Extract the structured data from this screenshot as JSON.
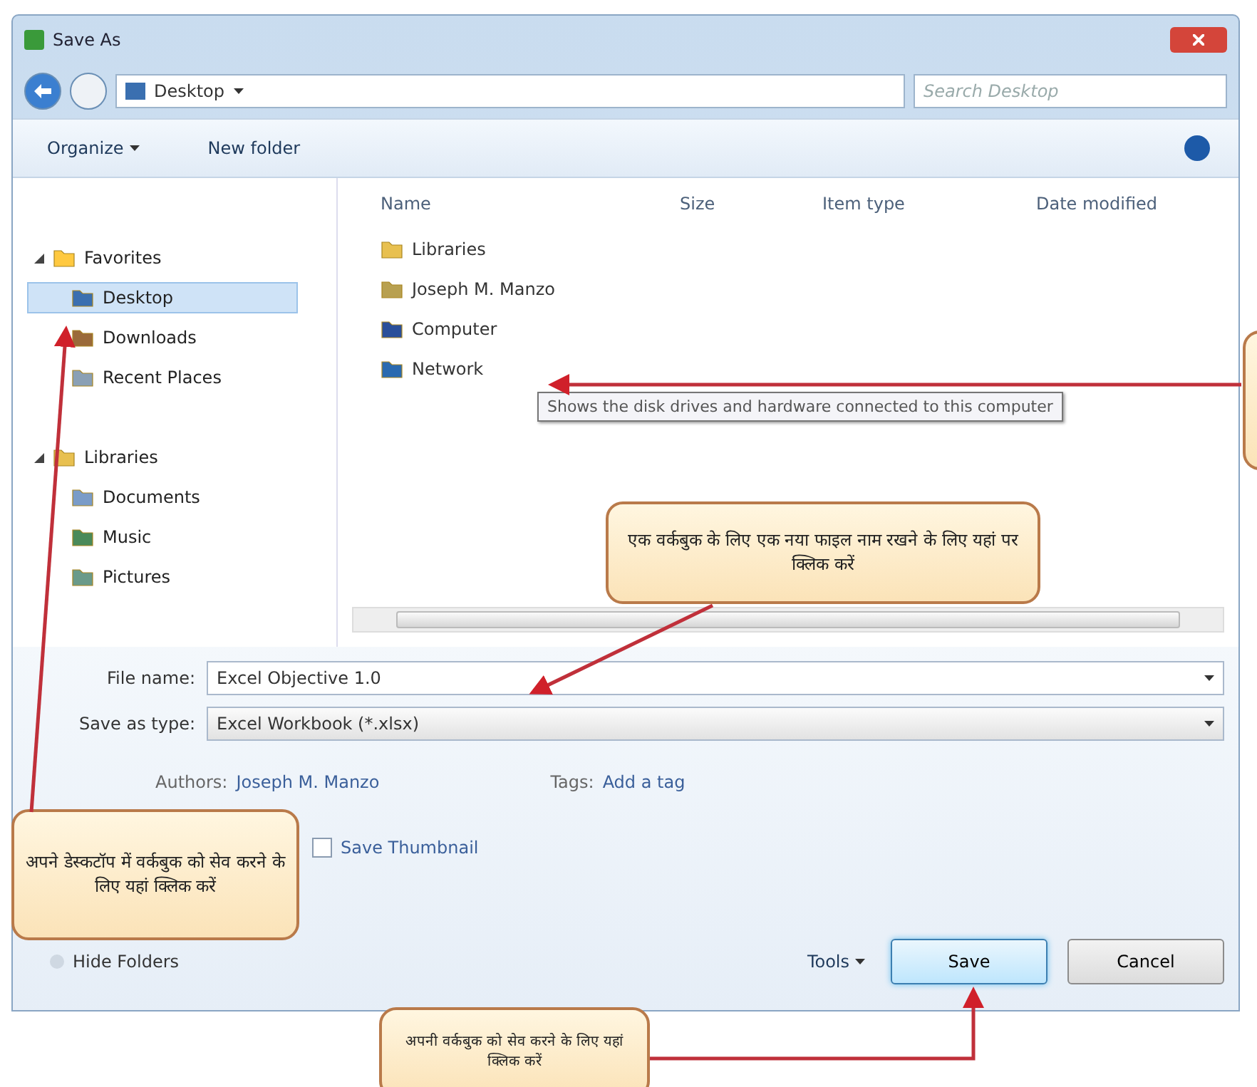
{
  "window": {
    "title": "Save As"
  },
  "address_bar": {
    "location": "Desktop",
    "search_placeholder": "Search Desktop"
  },
  "toolbar": {
    "items": [
      {
        "label": "Organize",
        "dropdown": true
      },
      {
        "label": "New folder",
        "dropdown": false
      }
    ]
  },
  "sidebar": {
    "groups": [
      {
        "label": "Favorites",
        "expanded": true,
        "children": [
          {
            "label": "Desktop",
            "selected": true
          },
          {
            "label": "Downloads",
            "selected": false
          },
          {
            "label": "Recent Places",
            "selected": false
          }
        ]
      },
      {
        "label": "Libraries",
        "expanded": true,
        "children": [
          {
            "label": "Documents",
            "selected": false
          },
          {
            "label": "Music",
            "selected": false
          },
          {
            "label": "Pictures",
            "selected": false
          }
        ]
      }
    ]
  },
  "file_list": {
    "columns": [
      "Name",
      "Size",
      "Item type",
      "Date modified"
    ],
    "items": [
      {
        "name": "Libraries"
      },
      {
        "name": "Joseph M. Manzo"
      },
      {
        "name": "Computer"
      },
      {
        "name": "Network"
      }
    ]
  },
  "tooltip": "Shows the disk drives and hardware connected to this computer",
  "form": {
    "fields": [
      {
        "label": "File name:",
        "value": "Excel Objective 1.0",
        "kind": "input"
      },
      {
        "label": "Save as type:",
        "value": "Excel Workbook (*.xlsx)",
        "kind": "select"
      }
    ],
    "authors": {
      "label": "Authors:",
      "value": "Joseph M. Manzo"
    },
    "tags": {
      "label": "Tags:",
      "value": "Add a tag"
    },
    "save_thumbnail": {
      "label": "Save Thumbnail",
      "checked": false
    }
  },
  "footer": {
    "hide_folders": "Hide Folders",
    "tools": "Tools",
    "buttons": [
      {
        "label": "Save",
        "default": true
      },
      {
        "label": "Cancel",
        "default": false
      }
    ]
  },
  "callouts": [
    "एक वर्कबुक के लिए एक नया फाइल नाम रखने के लिए यहां पर क्लिक करें",
    "अपने डेस्कटॉप में वर्कबुक को सेव करने के लिए यहां क्लिक करें",
    "अपनी वर्कबुक को सेव करने के लिए यहां क्लिक करें"
  ]
}
